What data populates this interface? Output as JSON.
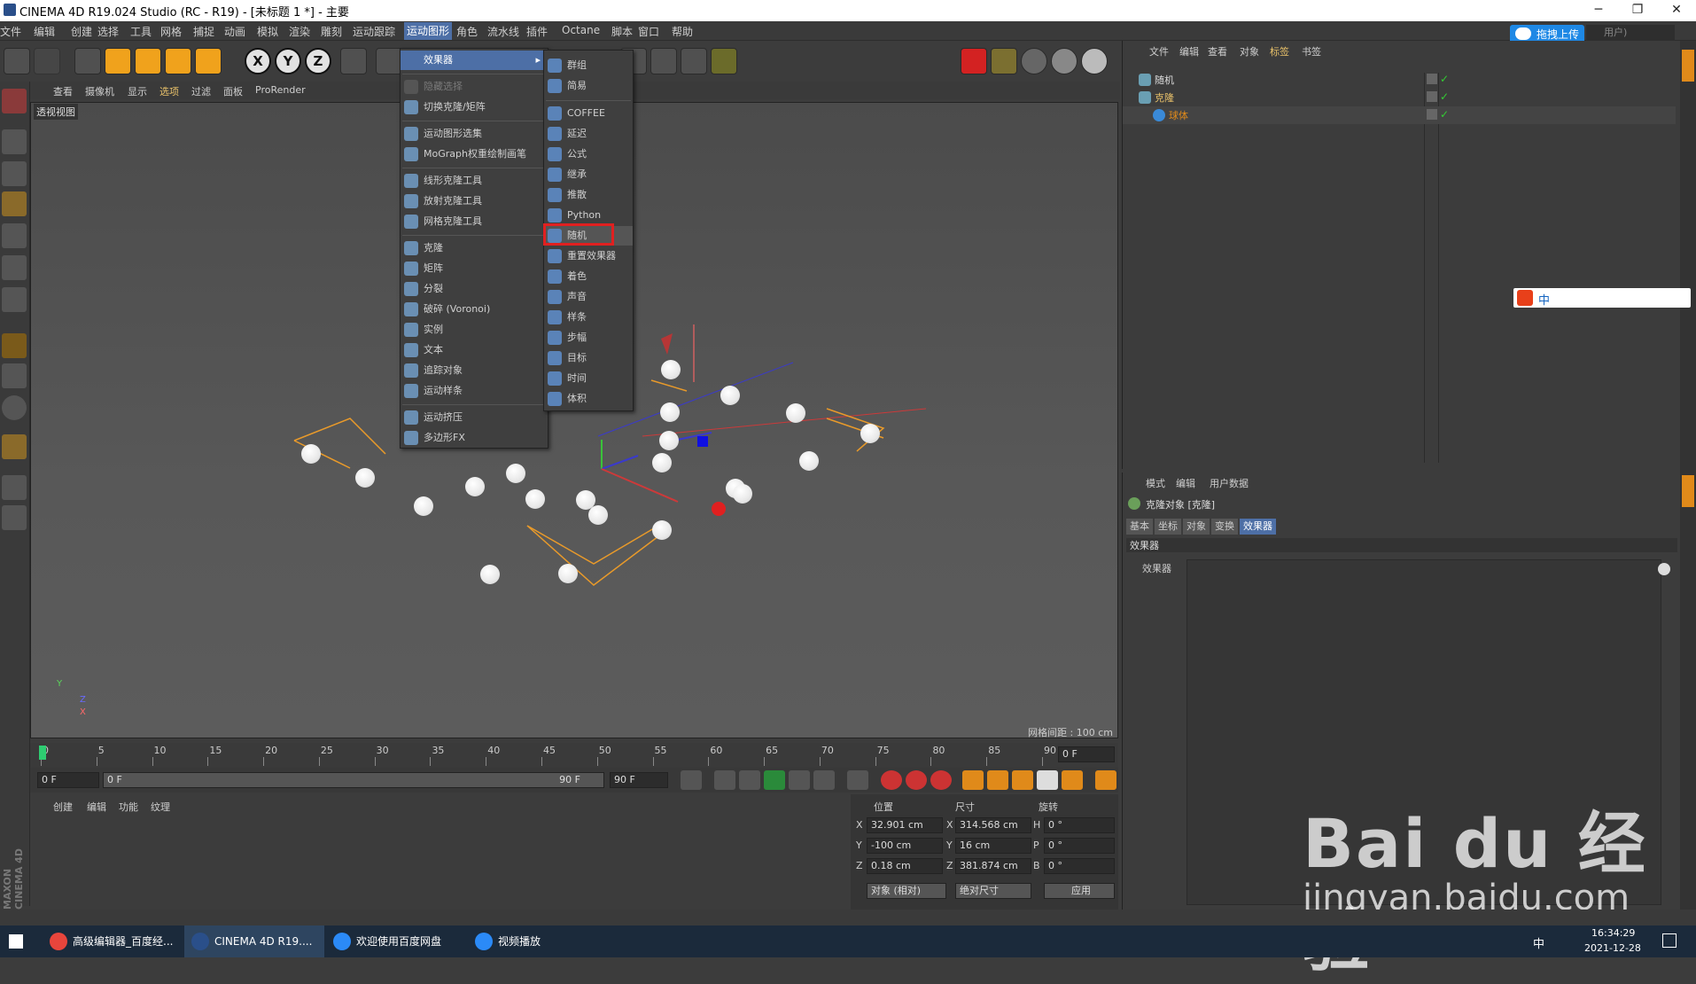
{
  "window": {
    "title": "CINEMA 4D R19.024 Studio (RC - R19) - [未标题 1 *] - 主要",
    "min": "─",
    "max": "❐",
    "close": "✕"
  },
  "menubar": [
    "文件",
    "编辑",
    "创建",
    "选择",
    "工具",
    "网格",
    "捕捉",
    "动画",
    "模拟",
    "渲染",
    "雕刻",
    "运动跟踪",
    "运动图形",
    "角色",
    "流水线",
    "插件",
    "Octane",
    "脚本",
    "窗口",
    "帮助"
  ],
  "menubar_active": "运动图形",
  "top_right": {
    "upload": "拖拽上传",
    "user": "用户)"
  },
  "axis_buttons": [
    "X",
    "Y",
    "Z"
  ],
  "vpmenu": [
    "查看",
    "摄像机",
    "显示",
    "选项",
    "过滤",
    "面板",
    "ProRender"
  ],
  "viewport": {
    "label": "透视视图",
    "grid_spacing": "网格间距 : 100 cm",
    "axis_y": "Y",
    "axis_z": "Z",
    "axis_x": "X"
  },
  "mograph_menu": {
    "groups": [
      [
        "效果器"
      ],
      [
        "隐藏选择",
        "切换克隆/矩阵"
      ],
      [
        "运动图形选集",
        "MoGraph权重绘制画笔"
      ],
      [
        "线形克隆工具",
        "放射克隆工具",
        "网格克隆工具"
      ],
      [
        "克隆",
        "矩阵",
        "分裂",
        "破碎 (Voronoi)",
        "实例",
        "文本",
        "追踪对象",
        "运动样条"
      ],
      [
        "运动挤压",
        "多边形FX"
      ]
    ]
  },
  "effector_menu": {
    "groups": [
      [
        "群组",
        "简易"
      ],
      [
        "COFFEE",
        "延迟",
        "公式",
        "继承",
        "推散",
        "Python",
        "随机",
        "重置效果器",
        "着色",
        "声音",
        "样条",
        "步幅",
        "目标",
        "时间",
        "体积"
      ]
    ],
    "highlighted": "随机"
  },
  "timeline": {
    "ticks": [
      "0",
      "5",
      "10",
      "15",
      "20",
      "25",
      "30",
      "35",
      "40",
      "45",
      "50",
      "55",
      "60",
      "65",
      "70",
      "75",
      "80",
      "85",
      "90"
    ],
    "frame_field": "0 F"
  },
  "transport": {
    "start": "0 F",
    "range_start": "0 F",
    "range_end": "90 F",
    "end": "90 F"
  },
  "material_menu": [
    "创建",
    "编辑",
    "功能",
    "纹理"
  ],
  "coord": {
    "headers": [
      "位置",
      "尺寸",
      "旋转"
    ],
    "rows": [
      {
        "axis": "X",
        "pos": "32.901 cm",
        "saxis": "X",
        "size": "314.568 cm",
        "raxis": "H",
        "rot": "0 °"
      },
      {
        "axis": "Y",
        "pos": "-100 cm",
        "saxis": "Y",
        "size": "16 cm",
        "raxis": "P",
        "rot": "0 °"
      },
      {
        "axis": "Z",
        "pos": "0.18 cm",
        "saxis": "Z",
        "size": "381.874 cm",
        "raxis": "B",
        "rot": "0 °"
      }
    ],
    "mode1": "对象 (相对)",
    "mode2": "绝对尺寸",
    "apply": "应用"
  },
  "objmanager": {
    "menu": [
      "文件",
      "编辑",
      "查看",
      "对象",
      "标签",
      "书签"
    ],
    "items": [
      {
        "name": "随机",
        "indent": 0
      },
      {
        "name": "克隆",
        "indent": 0
      },
      {
        "name": "球体",
        "indent": 1
      }
    ]
  },
  "attr": {
    "menu": [
      "模式",
      "编辑",
      "用户数据"
    ],
    "title": "克隆对象 [克隆]",
    "tabs": [
      "基本",
      "坐标",
      "对象",
      "变换",
      "效果器"
    ],
    "active_tab": "效果器",
    "section": "效果器",
    "field_label": "效果器"
  },
  "brand": "MAXON CINEMA 4D",
  "taskbar": {
    "items": [
      "高级编辑器_百度经...",
      "CINEMA 4D R19....",
      "欢迎使用百度网盘",
      "视频播放"
    ],
    "time": "16:34:29",
    "date": "2021-12-28",
    "ime": "中"
  },
  "sogou": "中",
  "watermark": {
    "logo": "Bai du 经验",
    "url": "jingyan.baidu.com"
  }
}
